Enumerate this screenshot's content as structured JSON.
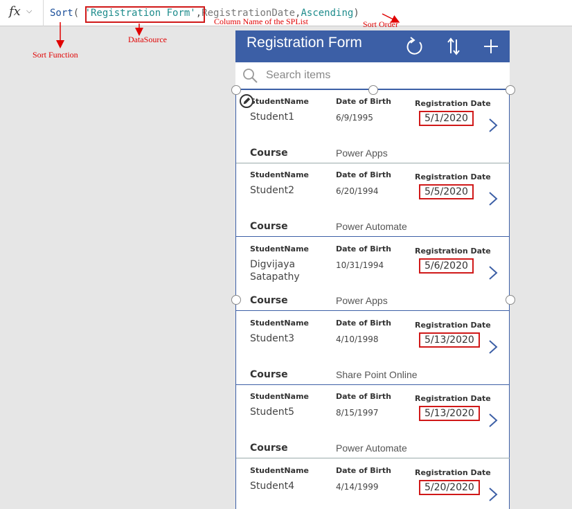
{
  "formula_bar": {
    "fx_label": "fx",
    "caret": "⌵",
    "tokens": {
      "fn": "Sort",
      "open": "( ",
      "source": "'Registration Form'",
      "comma1": ",",
      "column": "RegistrationDate",
      "comma2": ",",
      "order": "Ascending",
      "close": ")"
    }
  },
  "annotations": {
    "sort_function": "Sort Function",
    "datasource": "DataSource",
    "column_name": "Column Name of the SPList",
    "sort_order": "Sort Order"
  },
  "colors": {
    "header": "#3c5fa6",
    "highlight": "#d01818",
    "annotation": "#e00000"
  },
  "app": {
    "title": "Registration Form",
    "icons": [
      "refresh-icon",
      "sort-icon",
      "add-icon"
    ],
    "search_placeholder": "Search items",
    "labels": {
      "student_name": "StudentName",
      "dob": "Date of Birth",
      "reg_date": "Registration Date",
      "course": "Course"
    },
    "rows": [
      {
        "name": "Student1",
        "dob": "6/9/1995",
        "reg_date": "5/1/2020",
        "course": "Power Apps"
      },
      {
        "name": "Student2",
        "dob": "6/20/1994",
        "reg_date": "5/5/2020",
        "course": "Power Automate"
      },
      {
        "name": "Digvijaya Satapathy",
        "dob": "10/31/1994",
        "reg_date": "5/6/2020",
        "course": "Power Apps"
      },
      {
        "name": "Student3",
        "dob": "4/10/1998",
        "reg_date": "5/13/2020",
        "course": "Share Point Online"
      },
      {
        "name": "Student5",
        "dob": "8/15/1997",
        "reg_date": "5/13/2020",
        "course": "Power Automate"
      },
      {
        "name": "Student4",
        "dob": "4/14/1999",
        "reg_date": "5/20/2020",
        "course": ""
      }
    ]
  }
}
